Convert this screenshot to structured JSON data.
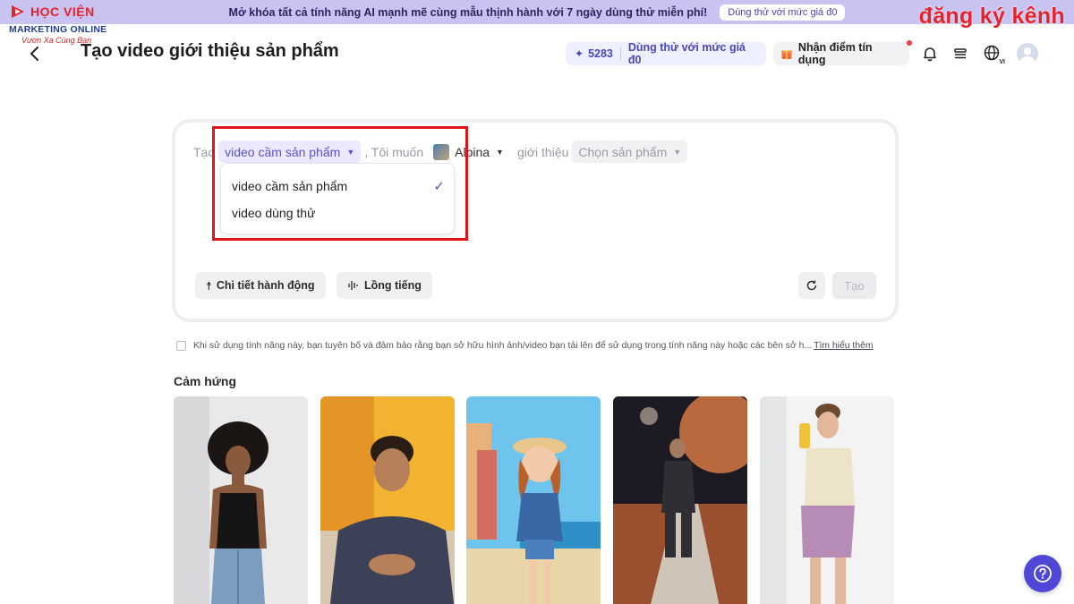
{
  "promo": {
    "text": "Mở khóa tất cả tính năng AI mạnh mẽ cùng mẫu thịnh hành với 7 ngày dùng thử miễn phí!",
    "button": "Dùng thử với mức giá đ0"
  },
  "brand": {
    "line1": "HỌC VIỆN",
    "line2": "MARKETING ONLINE",
    "line3": "Vươn Xa Cùng Bạn"
  },
  "watermark": "đăng ký kênh",
  "header": {
    "title": "Tạo video giới thiệu sản phẩm",
    "credits": "5283",
    "trial_label": "Dùng thử với mức giá đ0",
    "gift_label": "Nhận điểm tín dụng",
    "language_badge": "VI"
  },
  "prompt": {
    "prefix": "Tạo",
    "mode_selected": "video cầm sản phẩm",
    "middle": ", Tôi muốn",
    "avatar_name": "Albina",
    "connector": "giới thiệu",
    "product_placeholder": "Chọn sản phẩm",
    "dropdown_options": [
      {
        "label": "video cầm sản phẩm",
        "selected": true
      },
      {
        "label": "video dùng thử",
        "selected": false
      }
    ],
    "action_detail": "Chi tiết hành động",
    "voiceover": "Lồng tiếng",
    "create": "Tạo"
  },
  "disclaimer": {
    "text": "Khi sử dụng tính năng này, bạn tuyên bố và đảm bảo rằng bạn sở hữu hình ảnh/video bạn tải lên để sử dụng trong tính năng này hoặc các bên sở h...",
    "learn_more": "Tìm hiểu thêm"
  },
  "inspiration": {
    "title": "Cảm hứng"
  },
  "colors": {
    "accent": "#5b52c8",
    "promo_bg": "#c9c3f2",
    "highlight": "#e0141a",
    "help": "#4f47d6"
  },
  "icons": [
    "back-arrow-icon",
    "sparkle-icon",
    "gift-icon",
    "bell-icon",
    "stack-icon",
    "globe-icon",
    "check-icon",
    "caret-down-icon",
    "hand-icon",
    "waveform-icon",
    "refresh-icon",
    "help-icon"
  ]
}
